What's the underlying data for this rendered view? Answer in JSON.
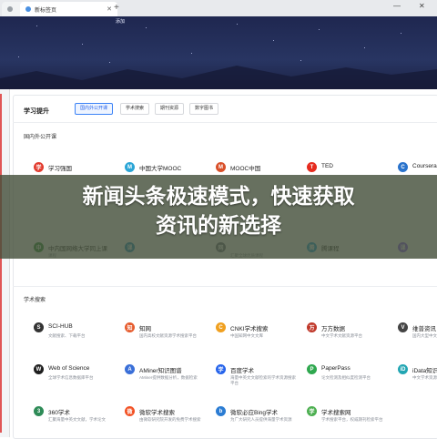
{
  "browser": {
    "tabs": [
      {
        "label": ""
      },
      {
        "label": "新标签页"
      }
    ],
    "new_tab_symbol": "+",
    "minimize_symbol": "—",
    "close_symbol": "✕"
  },
  "hero": {
    "label": "添加"
  },
  "panel": {
    "title": "学习提升",
    "tabs": [
      {
        "label": "国内外公开课",
        "active": true
      },
      {
        "label": "学术搜索",
        "active": false
      },
      {
        "label": "期刊资源",
        "active": false
      },
      {
        "label": "数字图书",
        "active": false
      }
    ]
  },
  "courses": {
    "title": "国内外公开课",
    "items": [
      {
        "name": "学习强国",
        "desc": "",
        "icon": "xuexi-icon",
        "color": "#e23b2e",
        "glyph": "学"
      },
      {
        "name": "中国大学MOOC",
        "desc": "",
        "icon": "mooc-cn-icon",
        "color": "#2aa5d6",
        "glyph": "M"
      },
      {
        "name": "MOOC中国",
        "desc": "",
        "icon": "mooc-china-icon",
        "color": "#d9502a",
        "glyph": "M"
      },
      {
        "name": "TED",
        "desc": "",
        "icon": "ted-icon",
        "color": "#e62b1e",
        "glyph": "T"
      },
      {
        "name": "Coursera",
        "desc": "",
        "icon": "coursera-icon",
        "color": "#2a73cc",
        "glyph": "C"
      },
      {
        "name": "中内国网络大学同上课",
        "desc": "课程",
        "icon": "wangluo-icon",
        "color": "#2f8f3a",
        "glyph": "中"
      },
      {
        "name": "",
        "desc": "",
        "icon": "course-icon-2",
        "color": "#1e90c8",
        "glyph": "课"
      },
      {
        "name": "",
        "desc": "汇聚全球优质课程",
        "icon": "course-icon-3",
        "color": "#6b7280",
        "glyph": "网"
      },
      {
        "name": "腾课程",
        "desc": "",
        "icon": "tengke-icon",
        "color": "#1aa3e0",
        "glyph": "腾"
      },
      {
        "name": "",
        "desc": "",
        "icon": "course-icon-5",
        "color": "#8b5cf6",
        "glyph": "课"
      }
    ]
  },
  "academic": {
    "title": "学术搜索",
    "items": [
      {
        "name": "SCI-HUB",
        "desc": "文献搜索、下载平台",
        "icon": "scihub-icon",
        "color": "#333333",
        "glyph": "S"
      },
      {
        "name": "知网",
        "desc": "国内高校文献资源学术搜索平台",
        "icon": "cnki-icon",
        "color": "#e65c2e",
        "glyph": "知"
      },
      {
        "name": "CNKI学术搜索",
        "desc": "中国知网中文文库",
        "icon": "cnki-search-icon",
        "color": "#f0a020",
        "glyph": "C"
      },
      {
        "name": "万方数据",
        "desc": "中文学术文献资源平台",
        "icon": "wanfang-icon",
        "color": "#c0392b",
        "glyph": "万"
      },
      {
        "name": "维普资讯",
        "desc": "国内大型中文期刊平台",
        "icon": "weipu-icon",
        "color": "#444444",
        "glyph": "V"
      },
      {
        "name": "Web of Science",
        "desc": "全球学术信息数据库平台",
        "icon": "wos-icon",
        "color": "#1f1f1f",
        "glyph": "W"
      },
      {
        "name": "AMiner知识图谱",
        "desc": "AMiner提供数据分析，数据检索",
        "icon": "aminer-icon",
        "color": "#3a6fd8",
        "glyph": "A"
      },
      {
        "name": "百度学术",
        "desc": "海量中英文文献检索的学术资源搜索平台",
        "icon": "baidu-xueshu-icon",
        "color": "#2563eb",
        "glyph": "学"
      },
      {
        "name": "PaperPass",
        "desc": "论文检测及相似度检测平台",
        "icon": "paperpass-icon",
        "color": "#2fa84f",
        "glyph": "P"
      },
      {
        "name": "iData知识检索",
        "desc": "中文学术资源检索平台",
        "icon": "idata-icon",
        "color": "#22a6b3",
        "glyph": "iD"
      },
      {
        "name": "360学术",
        "desc": "汇聚海量中英文文献，学术论文",
        "icon": "xueshu360-icon",
        "color": "#2e8b57",
        "glyph": "3"
      },
      {
        "name": "微软学术搜索",
        "desc": "由微软研究院开发的免费学术搜索",
        "icon": "ms-academic-icon",
        "color": "#f25022",
        "glyph": "微"
      },
      {
        "name": "微软必应Bing学术",
        "desc": "为广大研究人员提供海量学术资源",
        "icon": "bing-academic-icon",
        "color": "#2b7cd3",
        "glyph": "b"
      },
      {
        "name": "学术搜索网",
        "desc": "学术搜索平台，权威期刊检索平台",
        "icon": "xueshu-wang-icon",
        "color": "#4caf50",
        "glyph": "学"
      }
    ]
  },
  "overlay": {
    "line1": "新闻头条极速模式，快速获取",
    "line2": "资讯的新选择"
  }
}
